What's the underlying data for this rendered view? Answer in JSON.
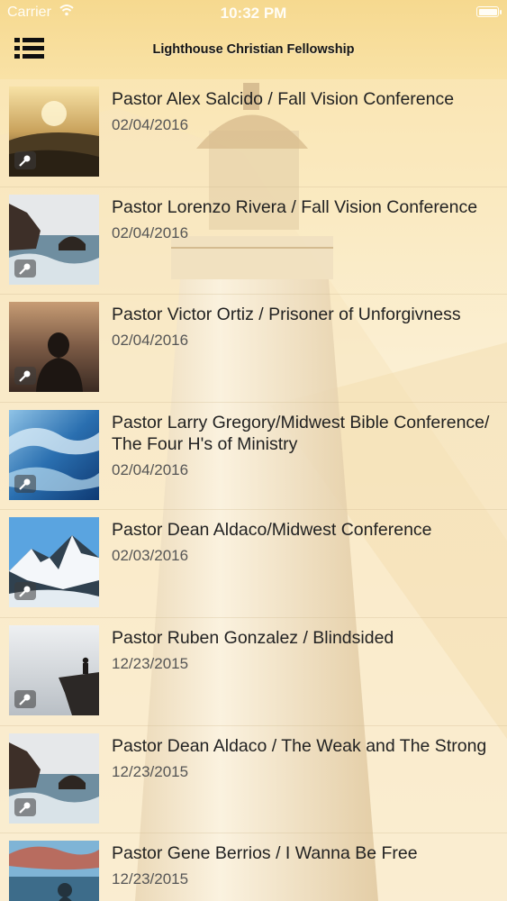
{
  "status_bar": {
    "carrier": "Carrier",
    "time": "10:32 PM"
  },
  "header": {
    "title": "Lighthouse Christian Fellowship",
    "menu_icon": "menu-list-icon"
  },
  "sermons": [
    {
      "title": "Pastor Alex Salcido / Fall Vision Conference",
      "date": "02/04/2016",
      "thumbnail": "sunrise-hills"
    },
    {
      "title": "Pastor Lorenzo Rivera / Fall Vision Conference",
      "date": "02/04/2016",
      "thumbnail": "sea-rocks"
    },
    {
      "title": "Pastor Victor Ortiz / Prisoner of Unforgivness",
      "date": "02/04/2016",
      "thumbnail": "person-silhouette"
    },
    {
      "title": "Pastor Larry Gregory/Midwest Bible Conference/ The Four H's of Ministry",
      "date": "02/04/2016",
      "thumbnail": "ocean-waves"
    },
    {
      "title": "Pastor Dean Aldaco/Midwest Conference",
      "date": "02/03/2016",
      "thumbnail": "snowy-mountains"
    },
    {
      "title": "Pastor Ruben Gonzalez / Blindsided",
      "date": "12/23/2015",
      "thumbnail": "cliff-edge"
    },
    {
      "title": "Pastor Dean Aldaco / The Weak and The Strong",
      "date": "12/23/2015",
      "thumbnail": "sea-rocks"
    },
    {
      "title": "Pastor Gene Berrios / I Wanna Be Free",
      "date": "12/23/2015",
      "thumbnail": "lake-sky"
    }
  ],
  "audio_badge_icon": "microphone-icon",
  "colors": {
    "header_bg": "#f6d98f",
    "text": "#222222",
    "date_text": "#555555"
  }
}
